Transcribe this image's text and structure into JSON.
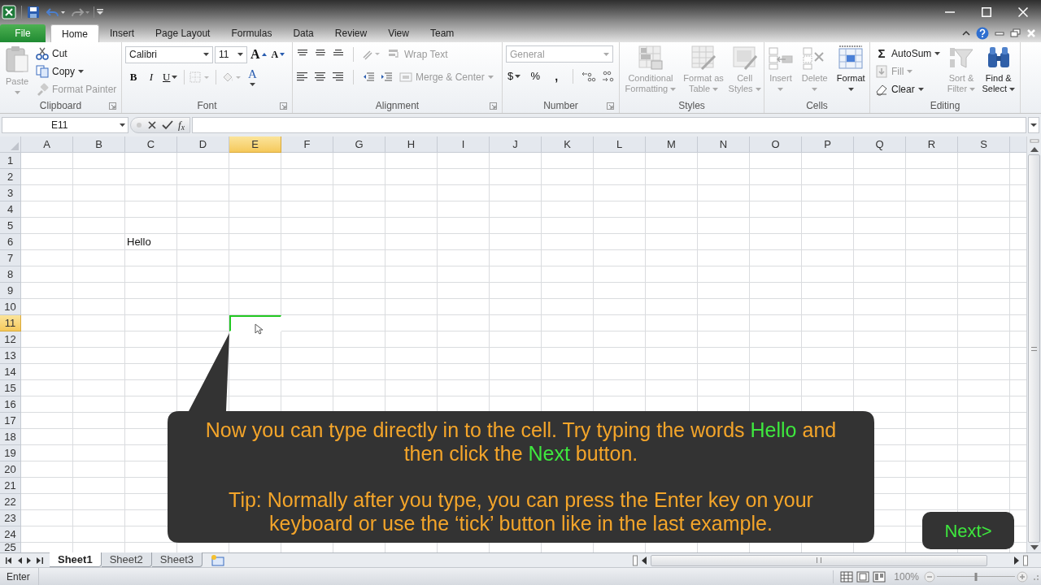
{
  "ribbon_tabs": [
    {
      "label": "File",
      "kind": "file",
      "selected": false
    },
    {
      "label": "Home",
      "kind": "tab",
      "selected": true
    },
    {
      "label": "Insert",
      "kind": "tab",
      "selected": false
    },
    {
      "label": "Page Layout",
      "kind": "tab",
      "selected": false
    },
    {
      "label": "Formulas",
      "kind": "tab",
      "selected": false
    },
    {
      "label": "Data",
      "kind": "tab",
      "selected": false
    },
    {
      "label": "Review",
      "kind": "tab",
      "selected": false
    },
    {
      "label": "View",
      "kind": "tab",
      "selected": false
    },
    {
      "label": "Team",
      "kind": "tab",
      "selected": false
    }
  ],
  "ribbon_groups": [
    {
      "label": "Clipboard",
      "items": [
        {
          "kind": "large",
          "label": "Paste",
          "disabled": true,
          "dropdown": true
        },
        {
          "kind": "small",
          "label": "Cut",
          "disabled": false,
          "dropdown": false
        },
        {
          "kind": "small",
          "label": "Copy",
          "disabled": false,
          "dropdown": true
        },
        {
          "kind": "small",
          "label": "Format Painter",
          "disabled": true,
          "dropdown": false
        }
      ]
    },
    {
      "label": "Font",
      "items": [
        {
          "kind": "field",
          "label": "Calibri",
          "disabled": false,
          "dropdown": true
        },
        {
          "kind": "field",
          "label": "11",
          "disabled": false,
          "dropdown": true
        },
        {
          "kind": "glyph",
          "label": "A",
          "disabled": false,
          "dropdown": false
        },
        {
          "kind": "glyph",
          "label": "A",
          "disabled": false,
          "dropdown": false
        },
        {
          "kind": "glyph",
          "label": "B",
          "disabled": false,
          "dropdown": false
        },
        {
          "kind": "glyph",
          "label": "I",
          "disabled": false,
          "dropdown": false
        },
        {
          "kind": "glyph",
          "label": "U",
          "disabled": false,
          "dropdown": true
        },
        {
          "kind": "glyph",
          "label": "A",
          "disabled": false,
          "dropdown": true
        }
      ]
    },
    {
      "label": "Alignment",
      "items": [
        {
          "kind": "small",
          "label": "Wrap Text",
          "disabled": true,
          "dropdown": false
        },
        {
          "kind": "small",
          "label": "Merge & Center",
          "disabled": true,
          "dropdown": true
        }
      ]
    },
    {
      "label": "Number",
      "items": [
        {
          "kind": "field",
          "label": "General",
          "disabled": true,
          "dropdown": true
        },
        {
          "kind": "glyph",
          "label": "$",
          "disabled": false,
          "dropdown": true
        },
        {
          "kind": "glyph",
          "label": "%",
          "disabled": false,
          "dropdown": false
        },
        {
          "kind": "glyph",
          "label": ",",
          "disabled": false,
          "dropdown": false
        }
      ]
    },
    {
      "label": "Styles",
      "items": [
        {
          "kind": "large",
          "label": "Conditional Formatting",
          "disabled": true,
          "dropdown": true
        },
        {
          "kind": "large",
          "label": "Format as Table",
          "disabled": true,
          "dropdown": true
        },
        {
          "kind": "large",
          "label": "Cell Styles",
          "disabled": true,
          "dropdown": true
        }
      ]
    },
    {
      "label": "Cells",
      "items": [
        {
          "kind": "large",
          "label": "Insert",
          "disabled": true,
          "dropdown": true
        },
        {
          "kind": "large",
          "label": "Delete",
          "disabled": true,
          "dropdown": true
        },
        {
          "kind": "large",
          "label": "Format",
          "disabled": false,
          "dropdown": true
        }
      ]
    },
    {
      "label": "Editing",
      "items": [
        {
          "kind": "small",
          "label": "AutoSum",
          "symbol": "Σ",
          "disabled": false,
          "dropdown": true
        },
        {
          "kind": "small",
          "label": "Fill",
          "disabled": true,
          "dropdown": true
        },
        {
          "kind": "small",
          "label": "Clear",
          "disabled": false,
          "dropdown": true
        },
        {
          "kind": "large",
          "label": "Sort & Filter",
          "disabled": true,
          "dropdown": true
        },
        {
          "kind": "large",
          "label": "Find & Select",
          "disabled": false,
          "dropdown": true
        }
      ]
    }
  ],
  "formula_bar": {
    "name_box": "E11",
    "function_label": "f$_{x}$"
  },
  "grid": {
    "columns": [
      {
        "label": "A",
        "selected": false
      },
      {
        "label": "B",
        "selected": false
      },
      {
        "label": "C",
        "selected": false
      },
      {
        "label": "D",
        "selected": false
      },
      {
        "label": "E",
        "selected": true
      },
      {
        "label": "F",
        "selected": false
      },
      {
        "label": "G",
        "selected": false
      },
      {
        "label": "H",
        "selected": false
      },
      {
        "label": "I",
        "selected": false
      },
      {
        "label": "J",
        "selected": false
      },
      {
        "label": "K",
        "selected": false
      },
      {
        "label": "L",
        "selected": false
      },
      {
        "label": "M",
        "selected": false
      },
      {
        "label": "N",
        "selected": false
      },
      {
        "label": "O",
        "selected": false
      },
      {
        "label": "P",
        "selected": false
      },
      {
        "label": "Q",
        "selected": false
      },
      {
        "label": "R",
        "selected": false
      },
      {
        "label": "S",
        "selected": false
      }
    ],
    "rows": [
      {
        "label": "1",
        "selected": false
      },
      {
        "label": "2",
        "selected": false
      },
      {
        "label": "3",
        "selected": false
      },
      {
        "label": "4",
        "selected": false
      },
      {
        "label": "5",
        "selected": false
      },
      {
        "label": "6",
        "selected": false,
        "cells": {
          "C": "Hello"
        }
      },
      {
        "label": "7",
        "selected": false
      },
      {
        "label": "8",
        "selected": false
      },
      {
        "label": "9",
        "selected": false
      },
      {
        "label": "10",
        "selected": false
      },
      {
        "label": "11",
        "selected": true
      },
      {
        "label": "12",
        "selected": false
      },
      {
        "label": "13",
        "selected": false
      },
      {
        "label": "14",
        "selected": false
      },
      {
        "label": "15",
        "selected": false
      },
      {
        "label": "16",
        "selected": false
      },
      {
        "label": "17",
        "selected": false
      },
      {
        "label": "18",
        "selected": false
      },
      {
        "label": "19",
        "selected": false
      },
      {
        "label": "20",
        "selected": false
      },
      {
        "label": "21",
        "selected": false
      },
      {
        "label": "22",
        "selected": false
      },
      {
        "label": "23",
        "selected": false
      },
      {
        "label": "24",
        "selected": false
      },
      {
        "label": "25",
        "selected": false
      }
    ]
  },
  "sheet_tabs": [
    {
      "label": "Sheet1",
      "selected": true
    },
    {
      "label": "Sheet2",
      "selected": false
    },
    {
      "label": "Sheet3",
      "selected": false
    }
  ],
  "status_bar": {
    "mode": "Enter",
    "zoom": "100%",
    "zoom_slider": {
      "level": 0.5
    }
  },
  "callout": {
    "paragraphs": [
      {
        "parts": [
          {
            "text": "Now you can type directly in to the cell. Try typing the words ",
            "highlight": false
          },
          {
            "text": "Hello",
            "highlight": true
          },
          {
            "text": " and then click the ",
            "highlight": false
          },
          {
            "text": "Next",
            "highlight": true
          },
          {
            "text": " button.",
            "highlight": false
          }
        ]
      },
      {
        "parts": [
          {
            "text": "Tip: Normally after you type, you can press the Enter key on your keyboard or use the ‘tick’ button like in the last example.",
            "highlight": false
          }
        ]
      }
    ]
  },
  "next_button": {
    "label": "Next>"
  }
}
